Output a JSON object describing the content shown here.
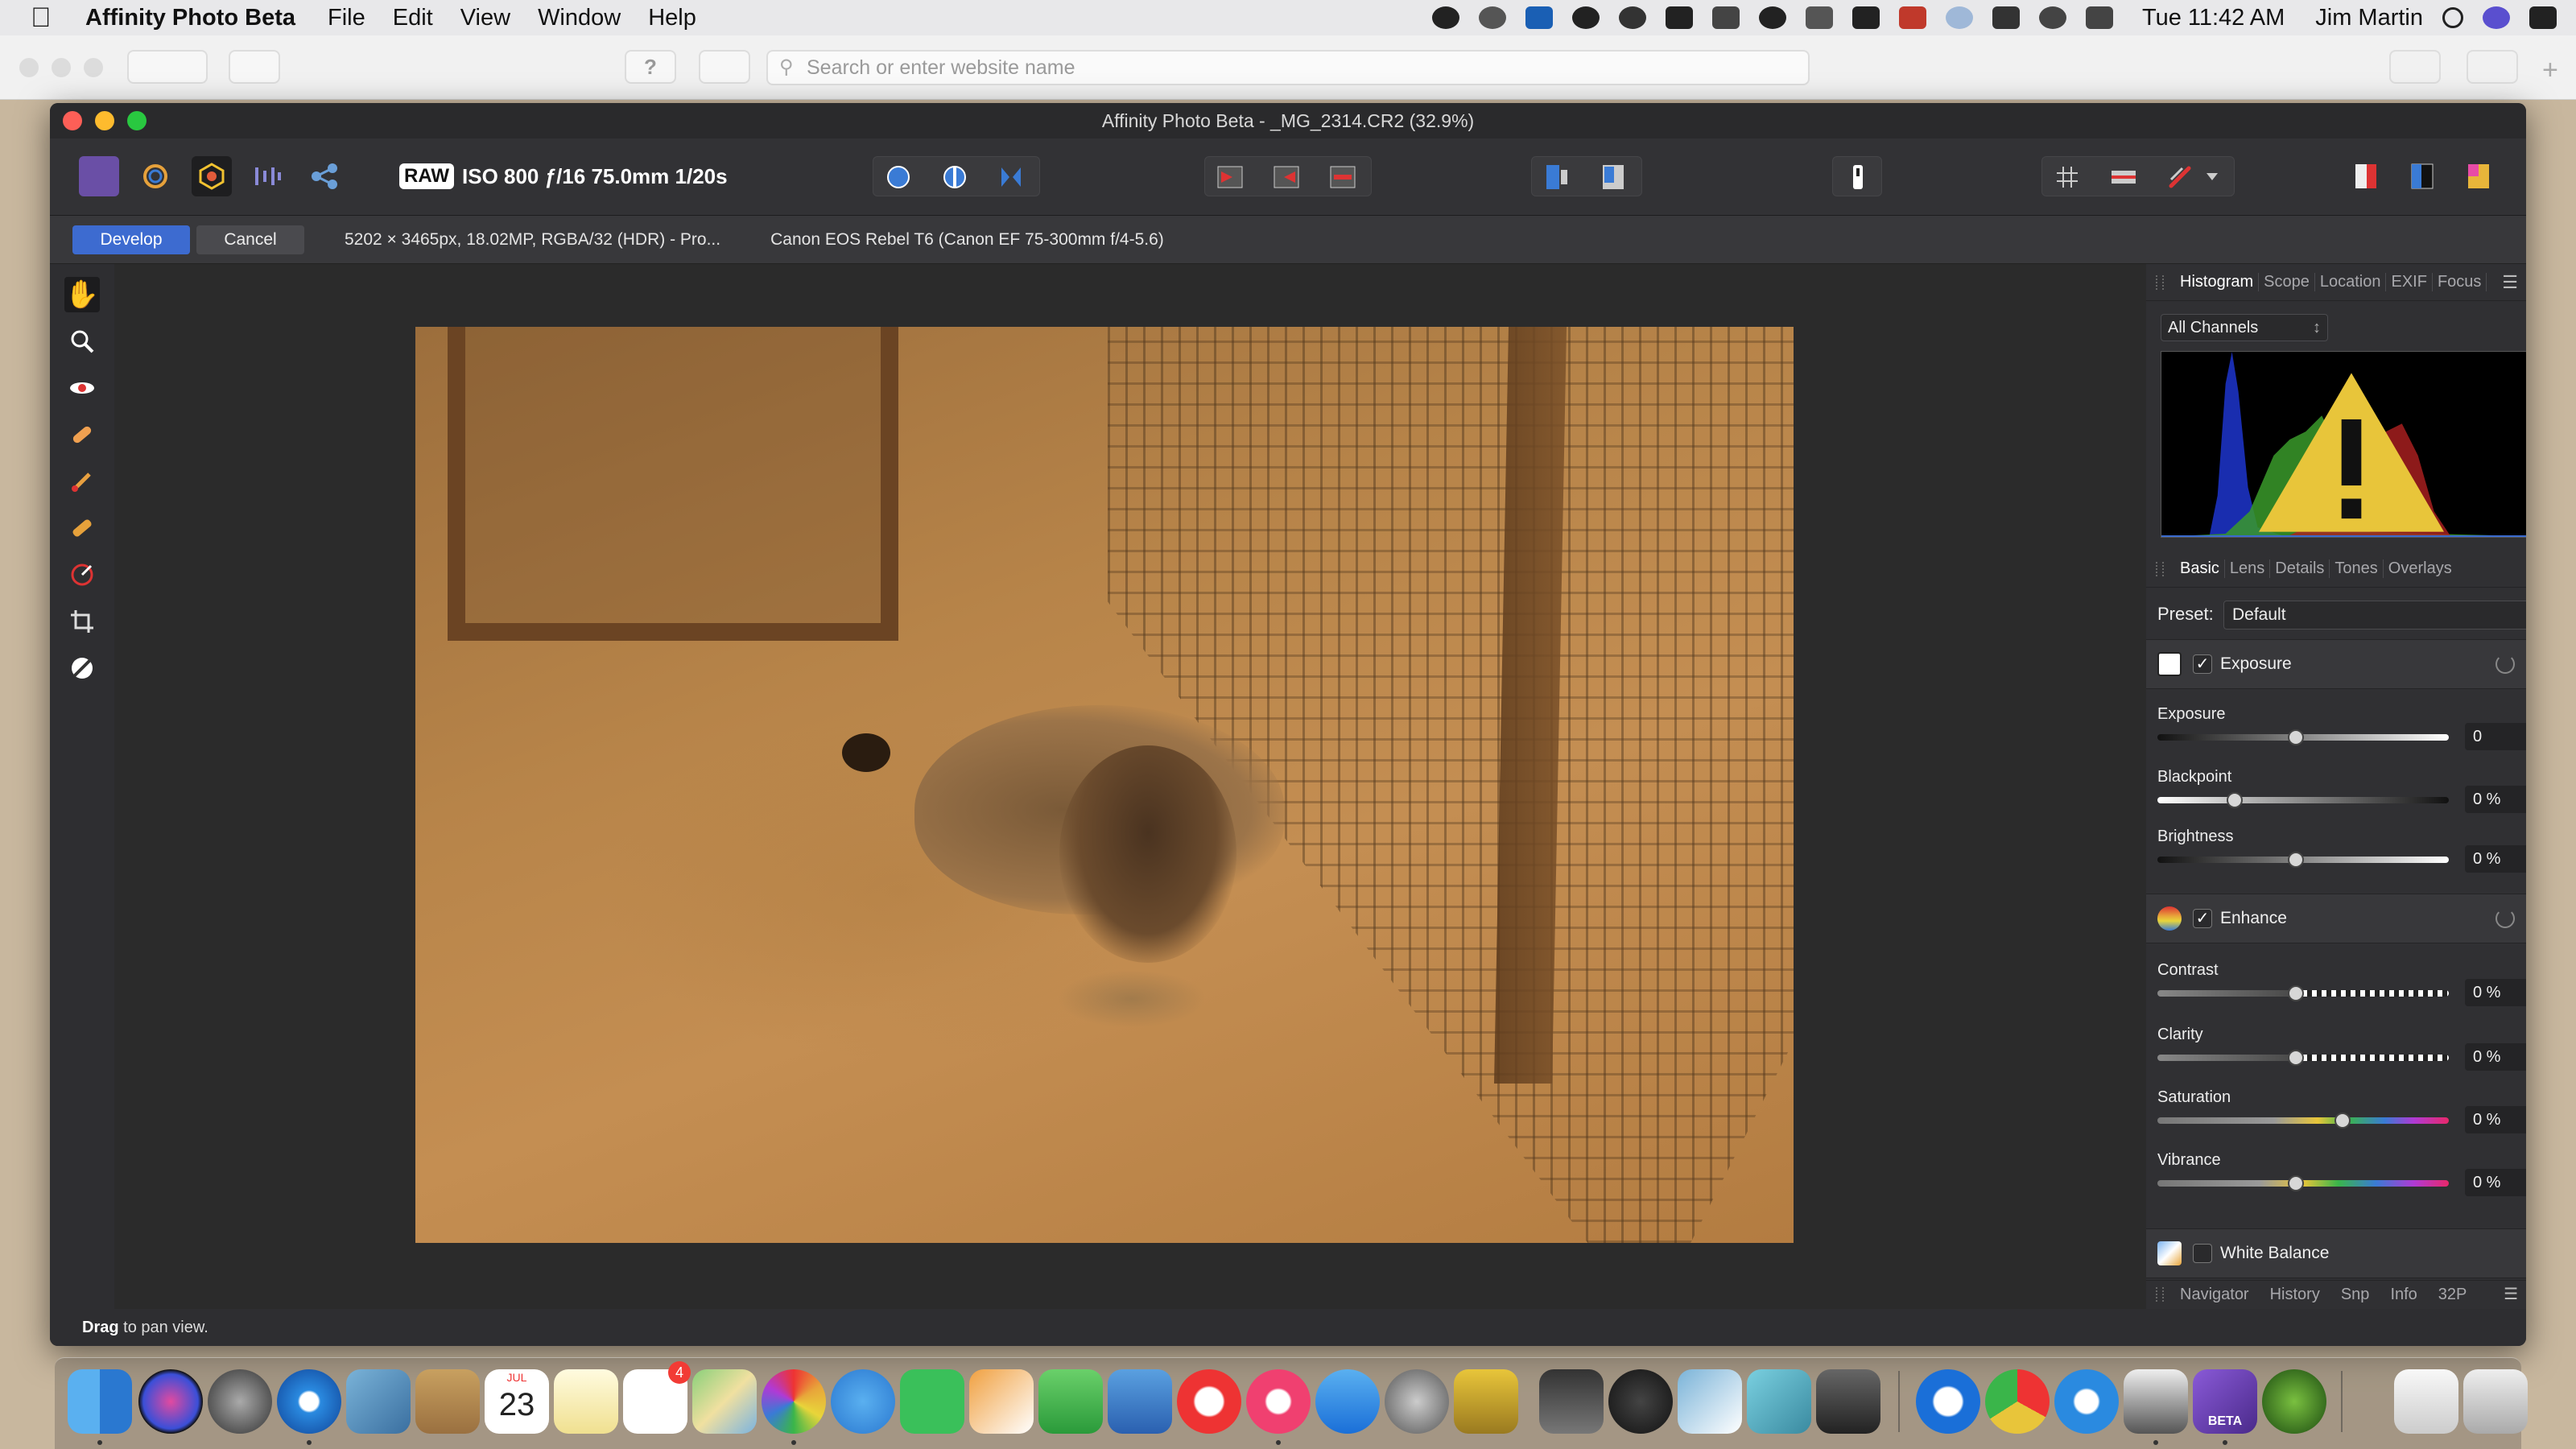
{
  "menubar": {
    "app_name": "Affinity Photo Beta",
    "menus": [
      "File",
      "Edit",
      "View",
      "Window",
      "Help"
    ],
    "clock": "Tue 11:42 AM",
    "user": "Jim Martin"
  },
  "browser": {
    "url_placeholder": "Search or enter website name",
    "help_label": "?"
  },
  "window": {
    "title": "Affinity Photo Beta - _MG_2314.CR2 (32.9%)"
  },
  "toolbar": {
    "raw_badge": "RAW",
    "exposure_info": "ISO 800 ƒ/16 75.0mm 1/20s"
  },
  "context": {
    "develop_label": "Develop",
    "cancel_label": "Cancel",
    "image_info": "5202 × 3465px, 18.02MP, RGBA/32 (HDR) - Pro...",
    "camera_info": "Canon EOS Rebel T6 (Canon EF 75-300mm f/4-5.6)"
  },
  "panel": {
    "top_tabs": [
      "Histogram",
      "Scope",
      "Location",
      "EXIF",
      "Focus"
    ],
    "channel_select": "All Channels",
    "basic_tabs": [
      "Basic",
      "Lens",
      "Details",
      "Tones",
      "Overlays"
    ],
    "preset_label": "Preset:",
    "preset_value": "Default",
    "exposure_section": {
      "name": "Exposure",
      "checked": true,
      "sliders": [
        {
          "label": "Exposure",
          "value": "0",
          "position": 0.5
        },
        {
          "label": "Blackpoint",
          "value": "0 %",
          "position": 0.3
        },
        {
          "label": "Brightness",
          "value": "0 %",
          "position": 0.5
        }
      ]
    },
    "enhance_section": {
      "name": "Enhance",
      "checked": true,
      "sliders": [
        {
          "label": "Contrast",
          "value": "0 %",
          "position": 0.5
        },
        {
          "label": "Clarity",
          "value": "0 %",
          "position": 0.5
        },
        {
          "label": "Saturation",
          "value": "0 %",
          "position": 0.66
        },
        {
          "label": "Vibrance",
          "value": "0 %",
          "position": 0.5
        }
      ]
    },
    "white_balance_section": {
      "name": "White Balance",
      "checked": false
    },
    "bottom_tabs": [
      "Navigator",
      "History",
      "Snp",
      "Info",
      "32P"
    ]
  },
  "status": {
    "bold": "Drag",
    "text": " to pan view."
  },
  "dock": {
    "calendar_month": "JUL",
    "calendar_day": "23",
    "reminders_badge": "4",
    "beta_label": "BETA"
  },
  "colors": {
    "accent": "#3d6bd0",
    "panel_bg": "#303033",
    "canvas_bg": "#2b2b2b"
  }
}
